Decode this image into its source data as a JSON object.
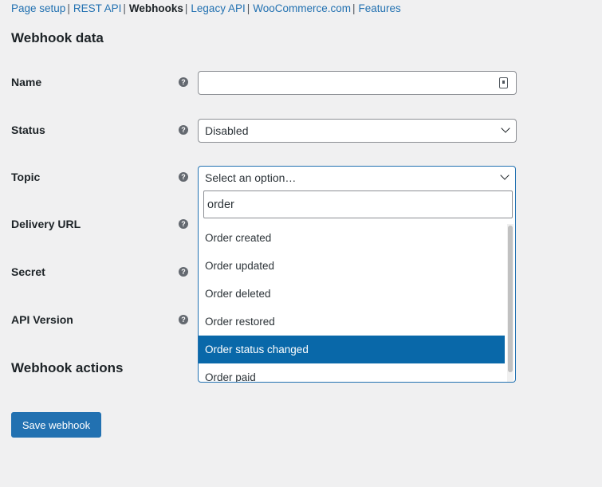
{
  "subnav": {
    "items": [
      {
        "label": "Page setup",
        "current": false
      },
      {
        "label": "REST API",
        "current": false
      },
      {
        "label": "Webhooks",
        "current": true
      },
      {
        "label": "Legacy API",
        "current": false
      },
      {
        "label": "WooCommerce.com",
        "current": false
      },
      {
        "label": "Features",
        "current": false
      }
    ],
    "separator": "|"
  },
  "section_title": "Webhook data",
  "help_glyph": "?",
  "fields": {
    "name": {
      "label": "Name",
      "value": ""
    },
    "status": {
      "label": "Status",
      "value": "Disabled"
    },
    "topic": {
      "label": "Topic",
      "value": "Select an option…"
    },
    "delivery_url": {
      "label": "Delivery URL"
    },
    "secret": {
      "label": "Secret"
    },
    "api_version": {
      "label": "API Version"
    }
  },
  "topic_dropdown": {
    "search_value": "order",
    "options": [
      {
        "label": "Order created",
        "highlighted": false
      },
      {
        "label": "Order updated",
        "highlighted": false
      },
      {
        "label": "Order deleted",
        "highlighted": false
      },
      {
        "label": "Order restored",
        "highlighted": false
      },
      {
        "label": "Order status changed",
        "highlighted": true
      },
      {
        "label": "Order paid",
        "highlighted": false
      }
    ]
  },
  "actions_title": "Webhook actions",
  "save_button": "Save webhook",
  "colors": {
    "link": "#2271b1",
    "highlight": "#0968a9",
    "button": "#2271b1",
    "background": "#f0f0f1"
  },
  "icons": {
    "help": "help-icon",
    "select_arrow": "chevron-down-icon",
    "password_manager": "password-manager-icon"
  }
}
